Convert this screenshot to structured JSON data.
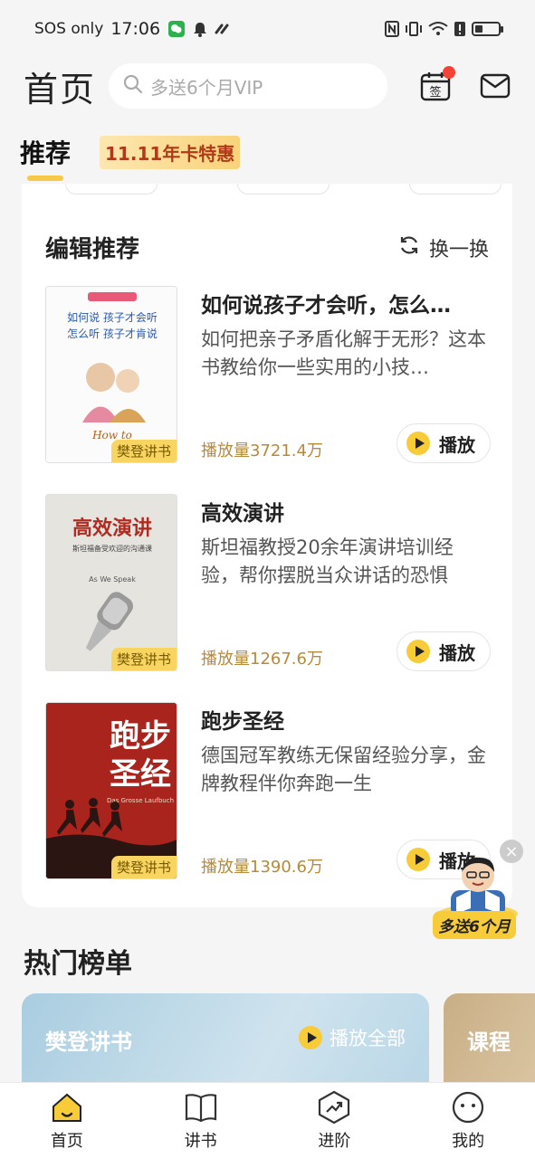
{
  "status_bar": {
    "carrier": "SOS only",
    "time": "17:06"
  },
  "header": {
    "title": "首页",
    "search_placeholder": "多送6个月VIP",
    "signin_label": "签"
  },
  "tabs": {
    "active": "推荐",
    "promo": "11.11年卡特惠"
  },
  "editor_picks": {
    "title": "编辑推荐",
    "refresh_label": "换一换",
    "books": [
      {
        "title": "如何说孩子才会听，怎么…",
        "desc": "如何把亲子矛盾化解于无形？这本书教给你一些实用的小技…",
        "plays": "播放量3721.4万",
        "play_label": "播放",
        "cover_tag": "樊登讲书",
        "cover_lines": [
          "如何说 孩子才会听",
          "怎么听 孩子才肯说"
        ],
        "cover_script": "How to",
        "cover_color": "#ffffff"
      },
      {
        "title": "高效演讲",
        "desc": "斯坦福教授20余年演讲培训经验，帮你摆脱当众讲话的恐惧",
        "plays": "播放量1267.6万",
        "play_label": "播放",
        "cover_tag": "樊登讲书",
        "cover_lines": [
          "高效演讲",
          "斯坦福备受欢迎的沟通课"
        ],
        "cover_script": "As We Speak",
        "cover_color": "#e6e4df"
      },
      {
        "title": "跑步圣经",
        "desc": "德国冠军教练无保留经验分享，金牌教程伴你奔跑一生",
        "plays": "播放量1390.6万",
        "play_label": "播放",
        "cover_tag": "樊登讲书",
        "cover_lines": [
          "跑步",
          "圣经"
        ],
        "cover_script": "Das Grosse Laufbuch",
        "cover_color": "#a8241d"
      }
    ]
  },
  "float_promo": {
    "label": "多送6个月",
    "close": "×"
  },
  "hot_list": {
    "title": "热门榜单",
    "card1_title": "樊登讲书",
    "card1_action": "播放全部",
    "card2_title": "课程"
  },
  "bottom_nav": [
    {
      "label": "首页",
      "icon": "home-icon"
    },
    {
      "label": "讲书",
      "icon": "book-icon"
    },
    {
      "label": "进阶",
      "icon": "growth-icon"
    },
    {
      "label": "我的",
      "icon": "profile-icon"
    }
  ],
  "colors": {
    "accent": "#f7cc38",
    "plays": "#b58a3b",
    "badge_red": "#f44336"
  }
}
